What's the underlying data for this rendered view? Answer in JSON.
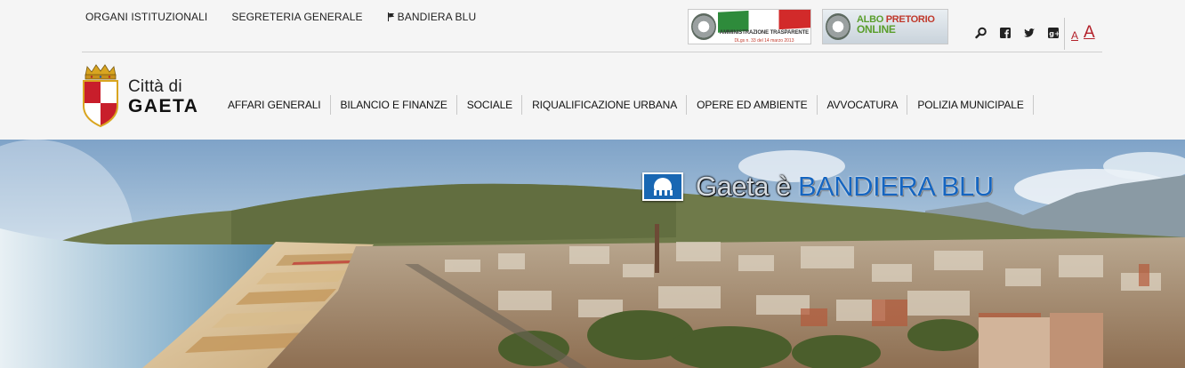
{
  "topbar": {
    "links": [
      {
        "label": "ORGANI ISTITUZIONALI"
      },
      {
        "label": "SEGRETERIA GENERALE"
      },
      {
        "label": "BANDIERA BLU"
      }
    ],
    "banner_trasparente": {
      "title": "AMMINISTRAZIONE TRASPARENTE",
      "subtitle": "DLgs n. 33 del 14 marzo 2013"
    },
    "banner_albo": {
      "word1": "ALBO",
      "word2": "PRETORIO",
      "word3": "ONLINE"
    },
    "icons": [
      "search-icon",
      "facebook-icon",
      "twitter-icon",
      "google-plus-icon"
    ],
    "font_size": {
      "small": "A",
      "large": "A"
    }
  },
  "logo": {
    "prefix": "Città di",
    "name": "GAETA"
  },
  "mainnav": [
    {
      "label": "AFFARI GENERALI"
    },
    {
      "label": "BILANCIO E FINANZE"
    },
    {
      "label": "SOCIALE"
    },
    {
      "label": "RIQUALIFICAZIONE URBANA"
    },
    {
      "label": "OPERE ED AMBIENTE"
    },
    {
      "label": "AVVOCATURA"
    },
    {
      "label": "POLIZIA MUNICIPALE"
    }
  ],
  "hero": {
    "caption_prefix": "Gaeta è",
    "caption_highlight": "BANDIERA BLU"
  },
  "colors": {
    "accent_red": "#b3222b",
    "bandiera_blue": "#1565c0"
  }
}
